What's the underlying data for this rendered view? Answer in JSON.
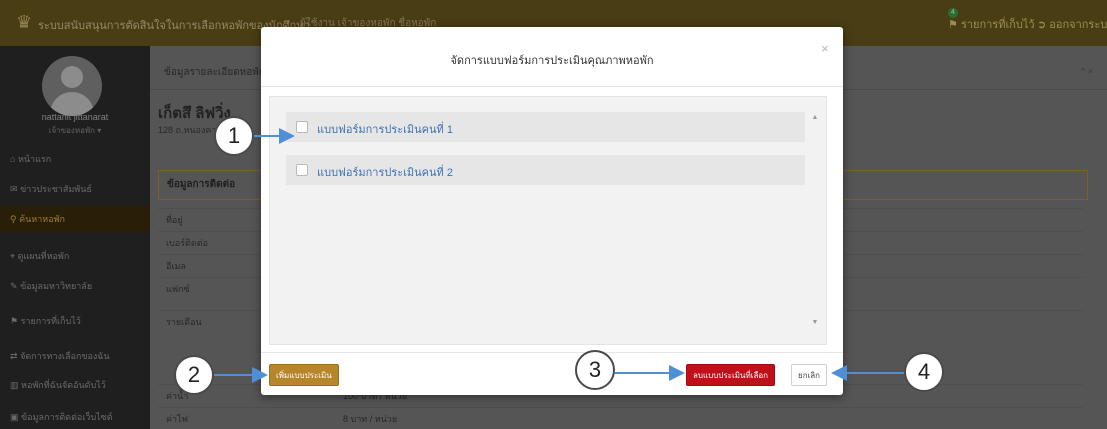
{
  "topbar": {
    "logo_icon": "temple-logo-icon",
    "app_title": "ระบบสนับสนุนการตัดสินใจในการเลือกหอพักของนักศึกษา",
    "user_line": "ผู้ใช้งาน เจ้าของหอพัก ชื่อหอพัก",
    "saved_badge": "4",
    "saved_label": "รายการที่เก็บไว้",
    "logout_label": "ออกจากระบบ"
  },
  "sidebar": {
    "user_name": "nattanit jittanarat",
    "user_role": "เจ้าของหอพัก ▾",
    "items": [
      {
        "icon": "⌂",
        "label": "หน้าแรก"
      },
      {
        "icon": "✉",
        "label": "ข่าวประชาสัมพันธ์"
      },
      {
        "icon": "⚲",
        "label": "ค้นหาหอพัก"
      },
      {
        "icon": "⌖",
        "label": "ดูแผนที่หอพัก"
      },
      {
        "icon": "✎",
        "label": "ข้อมูลมหาวิทยาลัย"
      },
      {
        "icon": "⚑",
        "label": "รายการที่เก็บไว้"
      },
      {
        "icon": "⇄",
        "label": "จัดการทางเลือกของฉัน"
      },
      {
        "icon": "▥",
        "label": "หอพักที่ฉันจัดอันดับไว้"
      },
      {
        "icon": "▣",
        "label": "ข้อมูลการติดต่อเว็บไซต์"
      }
    ]
  },
  "content": {
    "breadcrumb": "ข้อมูลรายละเอียดหอพัก",
    "crumb_controls": "^ ×",
    "dorm_title": "เก็ตสึ ลิฟวิ่ง",
    "dorm_address": "128 ถ.หนองคาย",
    "contact_header": "ข้อมูลการติดต่อ",
    "info_rows": [
      {
        "label": "ที่อยู่",
        "value": ""
      },
      {
        "label": "เบอร์ติดต่อ",
        "value": ""
      },
      {
        "label": "อีเมล",
        "value": ""
      },
      {
        "label": "แฟกซ์",
        "value": ""
      },
      {
        "label": "รายเดือน",
        "value": ""
      },
      {
        "label": "ค่าน้ำ",
        "value": "100 บาท / หน่วย"
      },
      {
        "label": "ค่าไฟ",
        "value": "8 บาท / หน่วย"
      }
    ]
  },
  "modal": {
    "title": "จัดการแบบฟอร์มการประเมินคุณภาพหอพัก",
    "close_label": "×",
    "forms": [
      {
        "label": "แบบฟอร์มการประเมินคนที่ 1",
        "checked": false
      },
      {
        "label": "แบบฟอร์มการประเมินคนที่ 2",
        "checked": false
      }
    ],
    "scroll_up": "▲",
    "scroll_down": "▼",
    "add_button": "เพิ่มแบบประเมิน",
    "delete_button": "ลบแบบประเมินที่เลือก",
    "cancel_button": "ยกเลิก"
  },
  "callouts": [
    "1",
    "2",
    "3",
    "4"
  ],
  "colors": {
    "accent_gold": "#b8862a",
    "danger_red": "#c0101a",
    "link_blue": "#3c73b4",
    "arrow_blue": "#4f8fd6"
  }
}
